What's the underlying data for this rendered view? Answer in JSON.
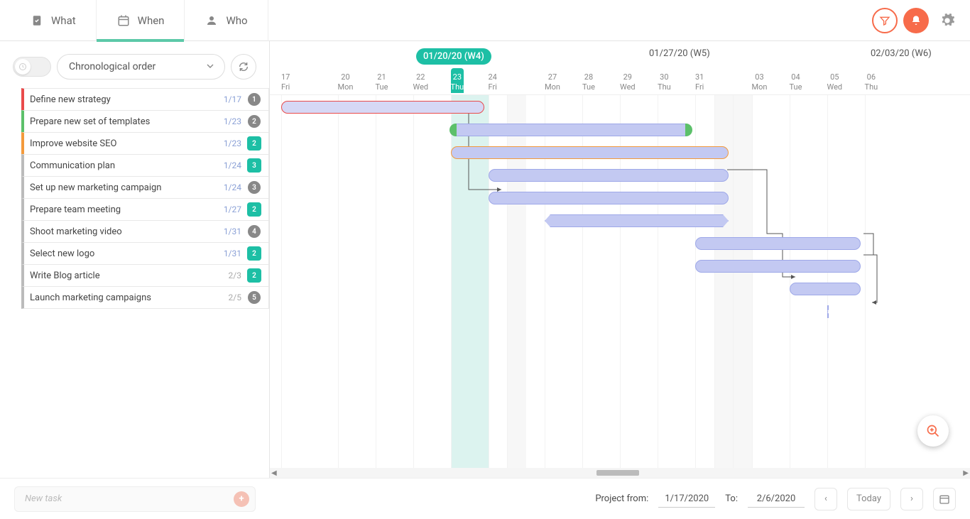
{
  "tabs": [
    {
      "label": "What"
    },
    {
      "label": "When"
    },
    {
      "label": "Who"
    }
  ],
  "active_tab": 1,
  "sort_label": "Chronological order",
  "weeks": [
    {
      "label": "01/20/20 (W4)",
      "active": true
    },
    {
      "label": "01/27/20 (W5)",
      "active": false
    },
    {
      "label": "02/03/20 (W6)",
      "active": false
    }
  ],
  "days": [
    {
      "d": "17",
      "dow": "Fri"
    },
    {
      "d": "20",
      "dow": "Mon"
    },
    {
      "d": "21",
      "dow": "Tue"
    },
    {
      "d": "22",
      "dow": "Wed"
    },
    {
      "d": "23",
      "dow": "Thu",
      "today": true
    },
    {
      "d": "24",
      "dow": "Fri"
    },
    {
      "d": "27",
      "dow": "Mon"
    },
    {
      "d": "28",
      "dow": "Tue"
    },
    {
      "d": "29",
      "dow": "Wed"
    },
    {
      "d": "30",
      "dow": "Thu"
    },
    {
      "d": "31",
      "dow": "Fri"
    },
    {
      "d": "03",
      "dow": "Mon"
    },
    {
      "d": "04",
      "dow": "Tue"
    },
    {
      "d": "05",
      "dow": "Wed"
    },
    {
      "d": "06",
      "dow": "Thu"
    }
  ],
  "tasks": [
    {
      "name": "Define new strategy",
      "date": "1/17",
      "color": "red",
      "assignee_type": "person",
      "assignee": "1"
    },
    {
      "name": "Prepare new set of templates",
      "date": "1/23",
      "color": "green",
      "assignee_type": "person",
      "assignee": "2"
    },
    {
      "name": "Improve website SEO",
      "date": "1/23",
      "color": "orange",
      "assignee_type": "badge",
      "assignee": "2"
    },
    {
      "name": "Communication plan",
      "date": "1/24",
      "color": "grey",
      "assignee_type": "badge",
      "assignee": "3"
    },
    {
      "name": "Set up new marketing campaign",
      "date": "1/24",
      "color": "grey",
      "assignee_type": "person",
      "assignee": "3"
    },
    {
      "name": "Prepare team meeting",
      "date": "1/27",
      "color": "grey",
      "assignee_type": "badge",
      "assignee": "2"
    },
    {
      "name": "Shoot marketing video",
      "date": "1/31",
      "color": "grey",
      "assignee_type": "person",
      "assignee": "4"
    },
    {
      "name": "Select new logo",
      "date": "1/31",
      "color": "grey",
      "assignee_type": "badge",
      "assignee": "2"
    },
    {
      "name": "Write Blog article",
      "date": "2/3",
      "date_grey": true,
      "color": "grey",
      "assignee_type": "badge",
      "assignee": "2"
    },
    {
      "name": "Launch marketing campaigns",
      "date": "2/5",
      "date_grey": true,
      "color": "grey",
      "assignee_type": "person",
      "assignee": "5"
    }
  ],
  "newtask_placeholder": "New task",
  "footer": {
    "project_from_label": "Project from:",
    "project_from": "1/17/2020",
    "to_label": "To:",
    "to": "2/6/2020",
    "today_label": "Today"
  }
}
